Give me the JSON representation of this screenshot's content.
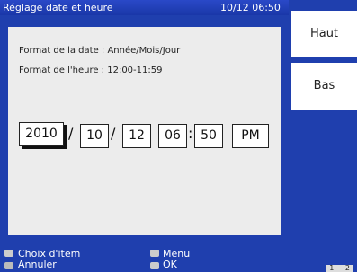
{
  "header": {
    "title": "Réglage date et heure",
    "clock": "10/12 06:50"
  },
  "info": {
    "date_format": "Format de la date : Année/Mois/Jour",
    "time_format": "Format de l'heure : 12:00-11:59"
  },
  "datetime": {
    "year": "2010",
    "month": "10",
    "day": "12",
    "hour": "06",
    "minute": "50",
    "ampm": "PM",
    "sep_slash": "/",
    "sep_colon": ":"
  },
  "side": {
    "up": "Haut",
    "down": "Bas"
  },
  "footer": {
    "choose": "Choix d'item",
    "cancel": "Annuler",
    "menu": "Menu",
    "ok": "OK",
    "page": "1",
    "page_total": "2"
  },
  "colors": {
    "background": "#1f3fae",
    "panel": "#ececec"
  }
}
